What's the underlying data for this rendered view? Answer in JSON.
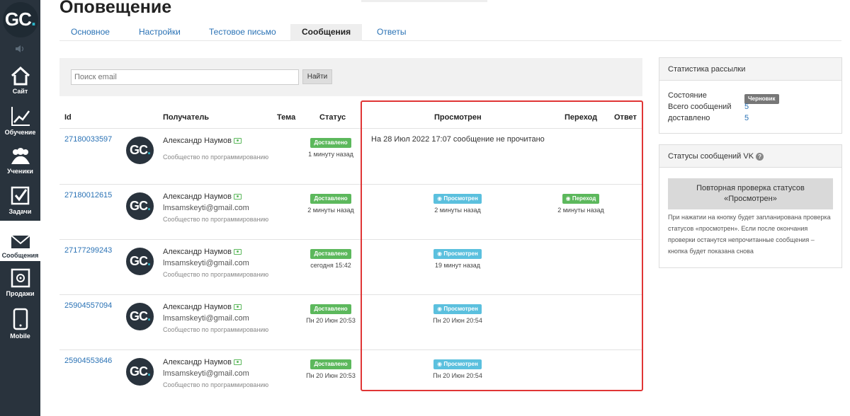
{
  "sidebar": {
    "logo_text": "GC",
    "logo_dot": ".",
    "items": [
      {
        "label": "Сайт",
        "icon": "house-icon"
      },
      {
        "label": "Обучение",
        "icon": "chart-icon"
      },
      {
        "label": "Ученики",
        "icon": "users-icon"
      },
      {
        "label": "Задачи",
        "icon": "checkbox-icon"
      },
      {
        "label": "Сообщения",
        "icon": "envelope-icon",
        "active": true
      },
      {
        "label": "Продажи",
        "icon": "safe-icon"
      },
      {
        "label": "Mobile",
        "icon": "phone-icon"
      }
    ]
  },
  "page": {
    "title": "Оповещение"
  },
  "tabs": [
    {
      "label": "Основное"
    },
    {
      "label": "Настройки"
    },
    {
      "label": "Тестовое письмо"
    },
    {
      "label": "Сообщения",
      "active": true
    },
    {
      "label": "Ответы"
    }
  ],
  "search": {
    "placeholder": "Поиск email",
    "button": "Найти"
  },
  "table": {
    "headers": {
      "id": "Id",
      "recipient": "Получатель",
      "subject": "Тема",
      "status": "Статус",
      "viewed": "Просмотрен",
      "clicked": "Переход",
      "reply": "Ответ"
    },
    "rows": [
      {
        "id": "27180033597",
        "name": "Александр Наумов",
        "email": "",
        "school": "Сообщество по программированию",
        "status": "Доставлено",
        "status_time": "1 минуту назад",
        "viewed": "",
        "viewed_time": "",
        "unread_note": "На 28 Июл 2022 17:07 сообщение не прочитано",
        "clicked": "",
        "clicked_time": ""
      },
      {
        "id": "27180012615",
        "name": "Александр Наумов",
        "email": "lmsamskeyti@gmail.com",
        "school": "Сообщество по программированию",
        "status": "Доставлено",
        "status_time": "2 минуты назад",
        "viewed": "Просмотрен",
        "viewed_time": "2 минуты назад",
        "unread_note": "",
        "clicked": "Переход",
        "clicked_time": "2 минуты назад"
      },
      {
        "id": "27177299243",
        "name": "Александр Наумов",
        "email": "lmsamskeyti@gmail.com",
        "school": "Сообщество по программированию",
        "status": "Доставлено",
        "status_time": "сегодня 15:42",
        "viewed": "Просмотрен",
        "viewed_time": "19 минут назад",
        "unread_note": "",
        "clicked": "",
        "clicked_time": ""
      },
      {
        "id": "25904557094",
        "name": "Александр Наумов",
        "email": "lmsamskeyti@gmail.com",
        "school": "Сообщество по программированию",
        "status": "Доставлено",
        "status_time": "Пн 20 Июн 20:53",
        "viewed": "Просмотрен",
        "viewed_time": "Пн 20 Июн 20:54",
        "unread_note": "",
        "clicked": "",
        "clicked_time": ""
      },
      {
        "id": "25904553646",
        "name": "Александр Наумов",
        "email": "lmsamskeyti@gmail.com",
        "school": "Сообщество по программированию",
        "status": "Доставлено",
        "status_time": "Пн 20 Июн 20:53",
        "viewed": "Просмотрен",
        "viewed_time": "Пн 20 Июн 20:54",
        "unread_note": "",
        "clicked": "",
        "clicked_time": ""
      }
    ]
  },
  "stats_panel": {
    "title": "Статистика рассылки",
    "state_label": "Состояние",
    "state_value": "Черновик",
    "total_label": "Всего сообщений",
    "total_value": "5",
    "delivered_label": "доставлено",
    "delivered_value": "5"
  },
  "vk_panel": {
    "title": "Статусы сообщений VK",
    "button_line1": "Повторная проверка статусов",
    "button_line2": "«Просмотрен»",
    "note": "При нажатии на кнопку будет запланирована проверка статусов «просмотрен». Если после окончания проверки останутся непрочитанные сообщения – кнопка будет показана снова"
  },
  "colors": {
    "sidebar": "#29333d",
    "link": "#2a72b5",
    "delivered": "#5cb85c",
    "viewed": "#5bc0de",
    "highlight": "#e03535",
    "brand_dot": "#2bb5c8"
  }
}
